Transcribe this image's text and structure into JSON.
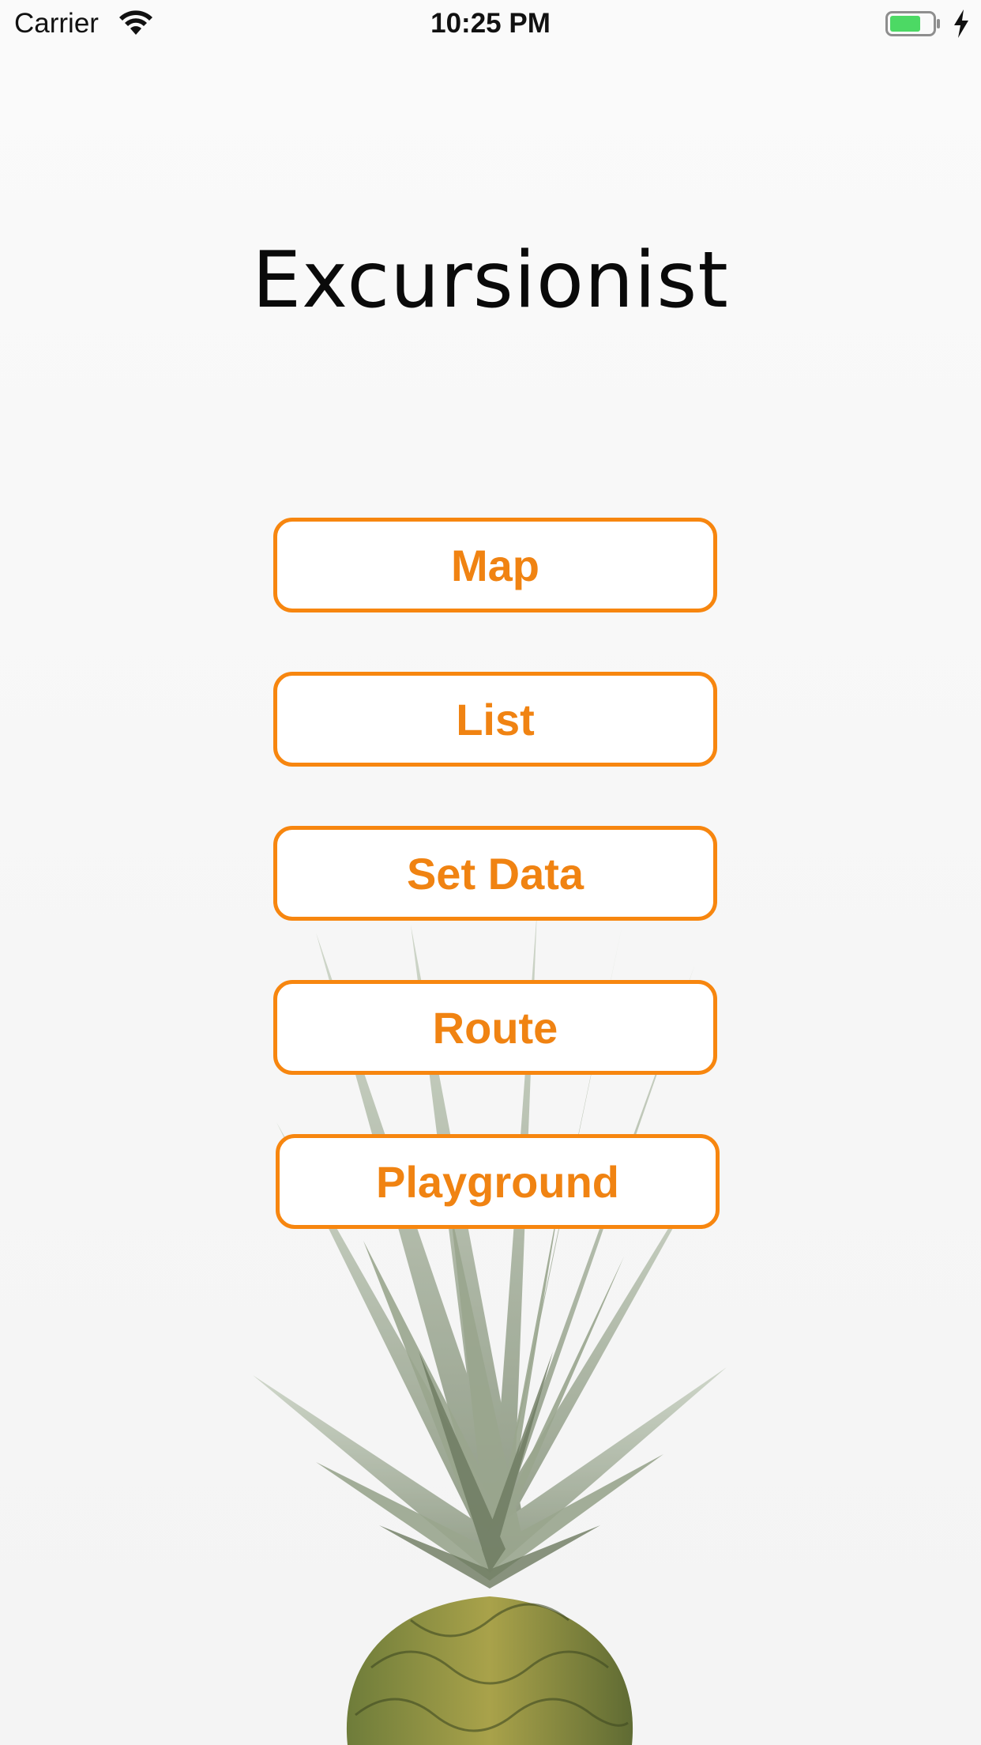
{
  "status_bar": {
    "carrier": "Carrier",
    "time": "10:25 PM",
    "icons": [
      "wifi-icon",
      "battery-icon",
      "charging-bolt-icon"
    ],
    "battery_color": "#4cd964"
  },
  "app": {
    "title": "Excursionist"
  },
  "menu": {
    "accent_color": "#f7860f",
    "buttons": [
      {
        "label": "Map"
      },
      {
        "label": "List"
      },
      {
        "label": "Set Data"
      },
      {
        "label": "Route"
      },
      {
        "label": "Playground"
      }
    ]
  },
  "background": {
    "image": "pineapple-image"
  }
}
